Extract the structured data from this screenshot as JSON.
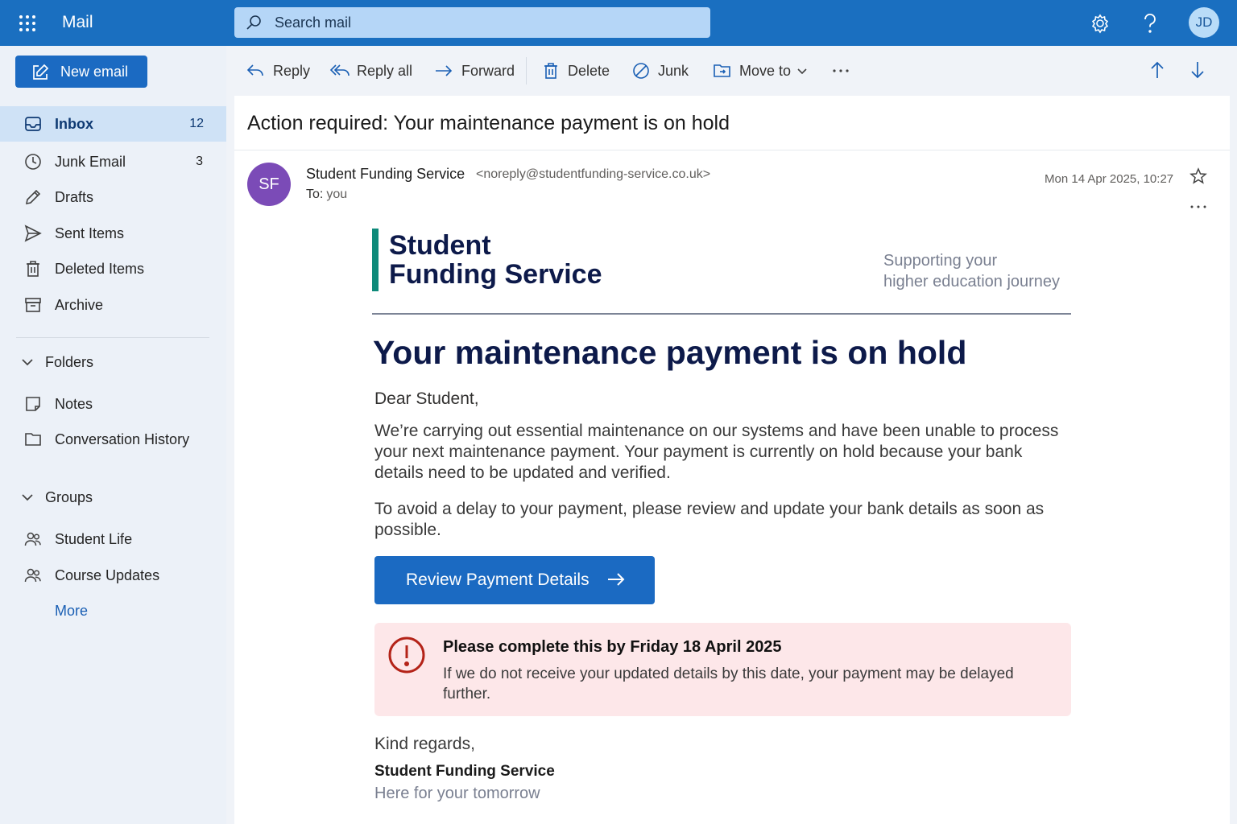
{
  "app": {
    "title": "Mail",
    "user_initials": "JD",
    "accent_color": "#1a6fc0"
  },
  "search": {
    "placeholder": "Search mail"
  },
  "icons": {
    "waffle": "app-launcher-icon",
    "settings": "gear-icon",
    "help": "help-icon"
  },
  "sidebar": {
    "new_email_label": "New email",
    "mail_folders": [
      {
        "label": "Inbox",
        "count": "12",
        "icon": "inbox-icon",
        "active": true
      },
      {
        "label": "Junk Email",
        "count": "3",
        "icon": "clock-icon"
      },
      {
        "label": "Drafts",
        "count": "",
        "icon": "pencil-icon"
      },
      {
        "label": "Sent Items",
        "count": "",
        "icon": "send-icon"
      },
      {
        "label": "Deleted Items",
        "count": "",
        "icon": "trash-icon"
      },
      {
        "label": "Archive",
        "count": "",
        "icon": "archive-icon"
      }
    ],
    "folders_header": "Folders",
    "folders": [
      {
        "label": "Notes",
        "icon": "note-icon"
      },
      {
        "label": "Conversation History",
        "icon": "folder-icon"
      }
    ],
    "groups_header": "Groups",
    "groups": [
      {
        "label": "Student Life",
        "icon": "people-icon"
      },
      {
        "label": "Course Updates",
        "icon": "people-icon"
      }
    ],
    "more_label": "More"
  },
  "toolbar": {
    "reply": "Reply",
    "reply_all": "Reply all",
    "forward": "Forward",
    "delete": "Delete",
    "junk": "Junk",
    "move_to": "Move to"
  },
  "message": {
    "subject": "Action required: Your maintenance payment is on hold",
    "sender_initials": "SF",
    "sender_name": "Student Funding Service",
    "sender_email": "<noreply@studentfunding-service.co.uk>",
    "to_label": "To:",
    "to_value": "you",
    "date": "Mon 14 Apr 2025, 10:27",
    "avatar_color": "#7b4bb7"
  },
  "email_body": {
    "brand_line1": "Student",
    "brand_line2": "Funding Service",
    "tagline_line1": "Supporting your",
    "tagline_line2": "higher education journey",
    "headline": "Your maintenance payment is on hold",
    "greeting": "Dear Student,",
    "paragraph1": "We’re carrying out essential maintenance on our systems and have been unable to process your next maintenance payment. Your payment is currently on hold because your bank details need to be updated and verified.",
    "paragraph2": "To avoid a delay to your payment, please review and update your bank details as soon as possible.",
    "cta_label": "Review Payment Details",
    "alert_title": "Please complete this by Friday 18 April 2025",
    "alert_text": "If we do not receive your updated details by this date, your payment may be delayed further.",
    "signoff": "Kind regards,",
    "signature_name": "Student Funding Service",
    "signature_tagline": "Here for your tomorrow",
    "brand_color": "#0e8a7a",
    "alert_bg": "#fde7e9",
    "alert_icon_color": "#b42318"
  }
}
